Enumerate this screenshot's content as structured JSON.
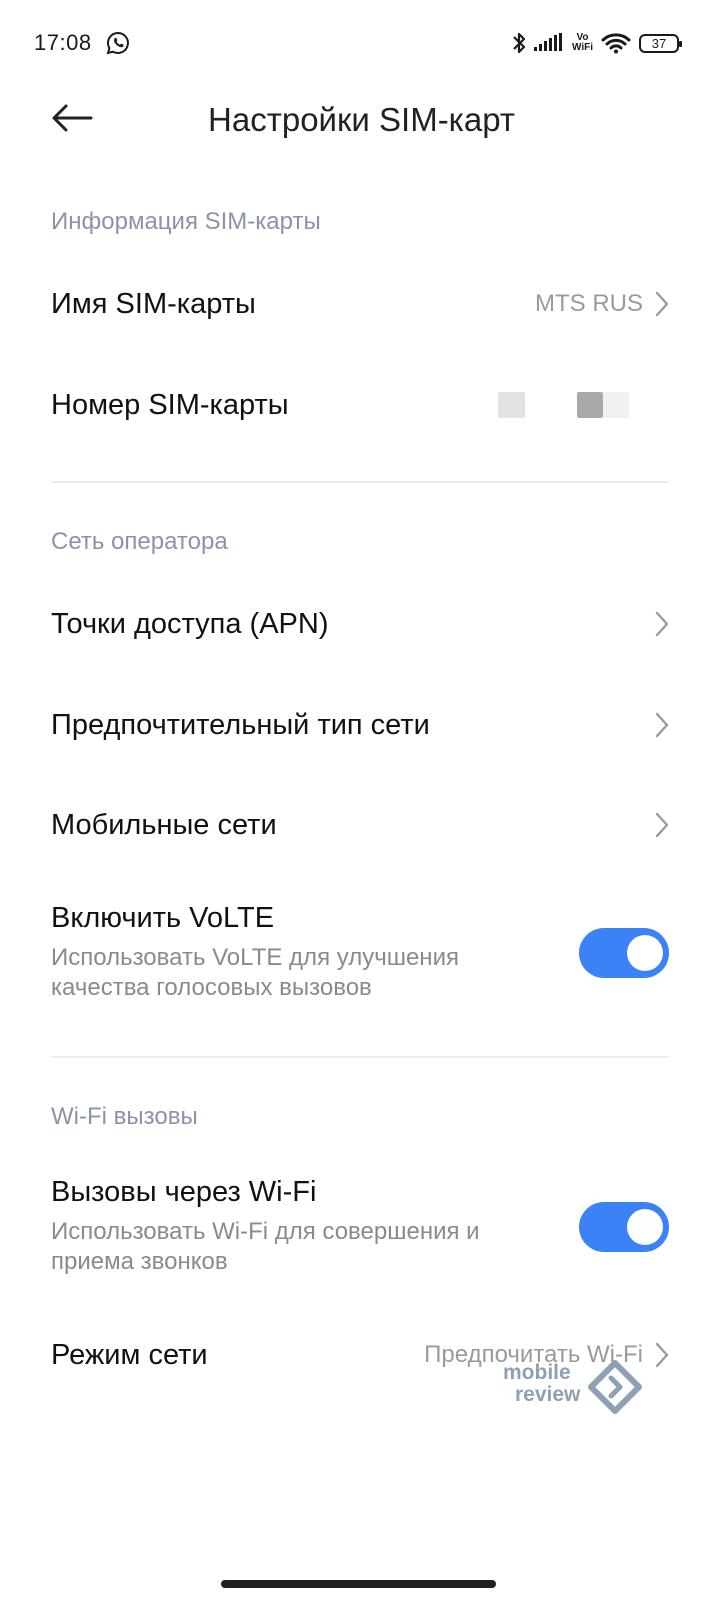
{
  "status_bar": {
    "time": "17:08",
    "network_label_top": "Vo",
    "network_label_bottom": "WiFi",
    "battery": "37"
  },
  "header": {
    "title": "Настройки SIM-карт"
  },
  "sections": {
    "sim_info": {
      "label": "Информация SIM-карты",
      "sim_name_label": "Имя SIM-карты",
      "sim_name_value": "MTS RUS",
      "sim_number_label": "Номер SIM-карты"
    },
    "operator": {
      "label": "Сеть оператора",
      "apn_label": "Точки доступа (APN)",
      "network_type_label": "Предпочтительный тип сети",
      "mobile_networks_label": "Мобильные сети",
      "volte_title": "Включить VoLTE",
      "volte_subtitle": "Использовать VoLTE для улучшения качества голосовых вызовов",
      "volte_enabled": true
    },
    "wifi_calls": {
      "label": "Wi-Fi вызовы",
      "wifi_calls_title": "Вызовы через Wi-Fi",
      "wifi_calls_subtitle": "Использовать Wi-Fi для совершения и приема звонков",
      "wifi_calls_enabled": true,
      "network_mode_label": "Режим сети",
      "network_mode_value": "Предпочитать Wi-Fi"
    }
  },
  "watermark": {
    "line1": "mobile",
    "line2": "review"
  },
  "colors": {
    "accent": "#3b82f6",
    "section_label": "#8a93a8",
    "secondary_text": "#8a8a8a"
  }
}
